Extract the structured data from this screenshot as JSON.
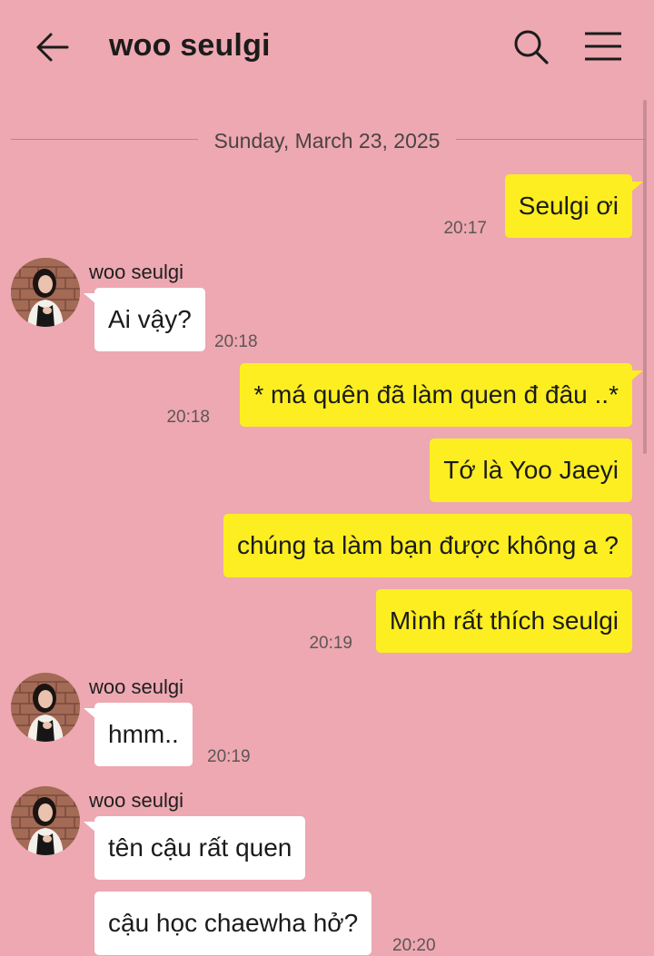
{
  "header": {
    "title": "woo seulgi",
    "back_icon": "arrow-left-icon",
    "search_icon": "search-icon",
    "menu_icon": "hamburger-menu-icon"
  },
  "colors": {
    "background": "#eda8b1",
    "outgoing_bubble": "#fdee22",
    "incoming_bubble": "#ffffff"
  },
  "date_separator": "Sunday, March 23, 2025",
  "messages": [
    {
      "direction": "out",
      "text": "Seulgi ơi",
      "time": "20:17"
    },
    {
      "direction": "in",
      "sender": "woo seulgi",
      "text": "Ai vậy?",
      "time": "20:18"
    },
    {
      "direction": "out",
      "text": "* má quên đã làm quen đ đâu ..*",
      "time": "20:18"
    },
    {
      "direction": "out",
      "text": "Tớ là Yoo Jaeyi",
      "time": ""
    },
    {
      "direction": "out",
      "text": "chúng ta làm bạn được không a ?",
      "time": ""
    },
    {
      "direction": "out",
      "text": "Mình rất thích seulgi",
      "time": "20:19"
    },
    {
      "direction": "in",
      "sender": "woo seulgi",
      "text": "hmm..",
      "time": "20:19"
    },
    {
      "direction": "in",
      "sender": "woo seulgi",
      "text": "tên cậu rất quen",
      "time": ""
    },
    {
      "direction": "in",
      "sender": "",
      "text": "cậu học chaewha hở?",
      "time": "20:20"
    }
  ]
}
